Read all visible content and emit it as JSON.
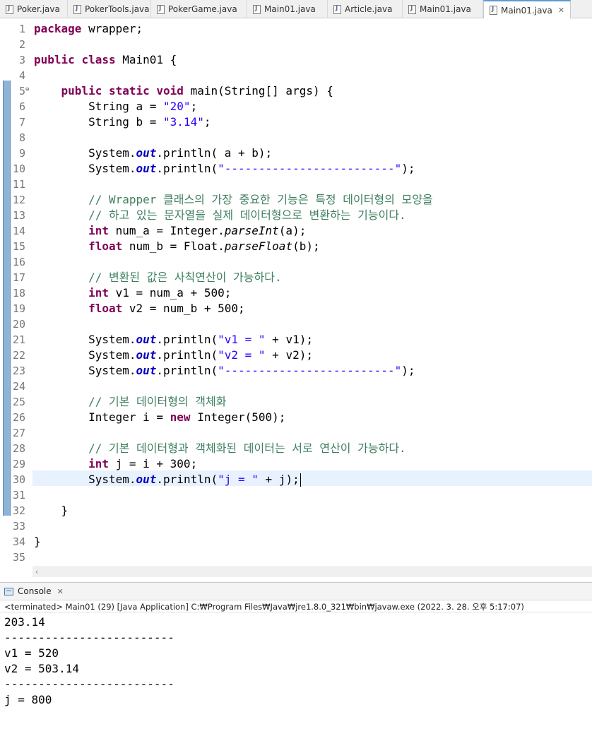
{
  "tabs": [
    {
      "label": "Poker.java",
      "active": false
    },
    {
      "label": "PokerTools.java",
      "active": false
    },
    {
      "label": "PokerGame.java",
      "active": false
    },
    {
      "label": "Main01.java",
      "active": false
    },
    {
      "label": "Article.java",
      "active": false
    },
    {
      "label": "Main01.java",
      "active": false
    },
    {
      "label": "Main01.java",
      "active": true
    }
  ],
  "editor": {
    "lines": [
      {
        "n": "1",
        "tokens": [
          [
            "kw",
            "package"
          ],
          [
            "t",
            " wrapper;"
          ]
        ]
      },
      {
        "n": "2",
        "tokens": []
      },
      {
        "n": "3",
        "tokens": [
          [
            "kw",
            "public"
          ],
          [
            "t",
            " "
          ],
          [
            "kw",
            "class"
          ],
          [
            "t",
            " Main01 {"
          ]
        ]
      },
      {
        "n": "4",
        "tokens": []
      },
      {
        "n": "5",
        "tokens": [
          [
            "t",
            "    "
          ],
          [
            "kw",
            "public"
          ],
          [
            "t",
            " "
          ],
          [
            "kw",
            "static"
          ],
          [
            "t",
            " "
          ],
          [
            "kw",
            "void"
          ],
          [
            "t",
            " main(String[] args) {"
          ]
        ]
      },
      {
        "n": "6",
        "tokens": [
          [
            "t",
            "        String a = "
          ],
          [
            "str",
            "\"20\""
          ],
          [
            "t",
            ";"
          ]
        ]
      },
      {
        "n": "7",
        "tokens": [
          [
            "t",
            "        String b = "
          ],
          [
            "str",
            "\"3.14\""
          ],
          [
            "t",
            ";"
          ]
        ]
      },
      {
        "n": "8",
        "tokens": []
      },
      {
        "n": "9",
        "tokens": [
          [
            "t",
            "        System."
          ],
          [
            "st",
            "out"
          ],
          [
            "t",
            ".println( a + b);"
          ]
        ]
      },
      {
        "n": "10",
        "tokens": [
          [
            "t",
            "        System."
          ],
          [
            "st",
            "out"
          ],
          [
            "t",
            ".println("
          ],
          [
            "str",
            "\"-------------------------\""
          ],
          [
            "t",
            ");"
          ]
        ]
      },
      {
        "n": "11",
        "tokens": []
      },
      {
        "n": "12",
        "tokens": [
          [
            "t",
            "        "
          ],
          [
            "cm",
            "// Wrapper 클래스의 가장 중요한 기능은 특정 데이터형의 모양을"
          ]
        ]
      },
      {
        "n": "13",
        "tokens": [
          [
            "t",
            "        "
          ],
          [
            "cm",
            "// 하고 있는 문자열을 실제 데이터형으로 변환하는 기능이다."
          ]
        ]
      },
      {
        "n": "14",
        "tokens": [
          [
            "t",
            "        "
          ],
          [
            "kw",
            "int"
          ],
          [
            "t",
            " num_a = Integer."
          ],
          [
            "it",
            "parseInt"
          ],
          [
            "t",
            "(a);"
          ]
        ]
      },
      {
        "n": "15",
        "tokens": [
          [
            "t",
            "        "
          ],
          [
            "kw",
            "float"
          ],
          [
            "t",
            " num_b = Float."
          ],
          [
            "it",
            "parseFloat"
          ],
          [
            "t",
            "(b);"
          ]
        ]
      },
      {
        "n": "16",
        "tokens": []
      },
      {
        "n": "17",
        "tokens": [
          [
            "t",
            "        "
          ],
          [
            "cm",
            "// 변환된 값은 사칙연산이 가능하다."
          ]
        ]
      },
      {
        "n": "18",
        "tokens": [
          [
            "t",
            "        "
          ],
          [
            "kw",
            "int"
          ],
          [
            "t",
            " v1 = num_a + 500;"
          ]
        ]
      },
      {
        "n": "19",
        "tokens": [
          [
            "t",
            "        "
          ],
          [
            "kw",
            "float"
          ],
          [
            "t",
            " v2 = num_b + 500;"
          ]
        ]
      },
      {
        "n": "20",
        "tokens": []
      },
      {
        "n": "21",
        "tokens": [
          [
            "t",
            "        System."
          ],
          [
            "st",
            "out"
          ],
          [
            "t",
            ".println("
          ],
          [
            "str",
            "\"v1 = \""
          ],
          [
            "t",
            " + v1);"
          ]
        ]
      },
      {
        "n": "22",
        "tokens": [
          [
            "t",
            "        System."
          ],
          [
            "st",
            "out"
          ],
          [
            "t",
            ".println("
          ],
          [
            "str",
            "\"v2 = \""
          ],
          [
            "t",
            " + v2);"
          ]
        ]
      },
      {
        "n": "23",
        "tokens": [
          [
            "t",
            "        System."
          ],
          [
            "st",
            "out"
          ],
          [
            "t",
            ".println("
          ],
          [
            "str",
            "\"-------------------------\""
          ],
          [
            "t",
            ");"
          ]
        ]
      },
      {
        "n": "24",
        "tokens": []
      },
      {
        "n": "25",
        "tokens": [
          [
            "t",
            "        "
          ],
          [
            "cm",
            "// 기본 데이터형의 객체화"
          ]
        ]
      },
      {
        "n": "26",
        "tokens": [
          [
            "t",
            "        Integer i = "
          ],
          [
            "kw",
            "new"
          ],
          [
            "t",
            " Integer(500);"
          ]
        ]
      },
      {
        "n": "27",
        "tokens": []
      },
      {
        "n": "28",
        "tokens": [
          [
            "t",
            "        "
          ],
          [
            "cm",
            "// 기본 데이터형과 객체화된 데이터는 서로 연산이 가능하다."
          ]
        ]
      },
      {
        "n": "29",
        "tokens": [
          [
            "t",
            "        "
          ],
          [
            "kw",
            "int"
          ],
          [
            "t",
            " j = i + 300;"
          ]
        ]
      },
      {
        "n": "30",
        "tokens": [
          [
            "t",
            "        System."
          ],
          [
            "st",
            "out"
          ],
          [
            "t",
            ".println("
          ],
          [
            "str",
            "\"j = \""
          ],
          [
            "t",
            " + j);"
          ]
        ],
        "caret": true
      },
      {
        "n": "31",
        "tokens": []
      },
      {
        "n": "32",
        "tokens": [
          [
            "t",
            "    }"
          ]
        ]
      },
      {
        "n": "33",
        "tokens": []
      },
      {
        "n": "34",
        "tokens": [
          [
            "t",
            "}"
          ]
        ]
      },
      {
        "n": "35",
        "tokens": []
      }
    ],
    "fold_marker_line": "5"
  },
  "console": {
    "title": "Console",
    "status": "<terminated> Main01 (29) [Java Application] C:₩Program Files₩Java₩jre1.8.0_321₩bin₩javaw.exe (2022. 3. 28. 오후 5:17:07)",
    "output": [
      "203.14",
      "-------------------------",
      "v1 = 520",
      "v2 = 503.14",
      "-------------------------",
      "j = 800"
    ]
  }
}
